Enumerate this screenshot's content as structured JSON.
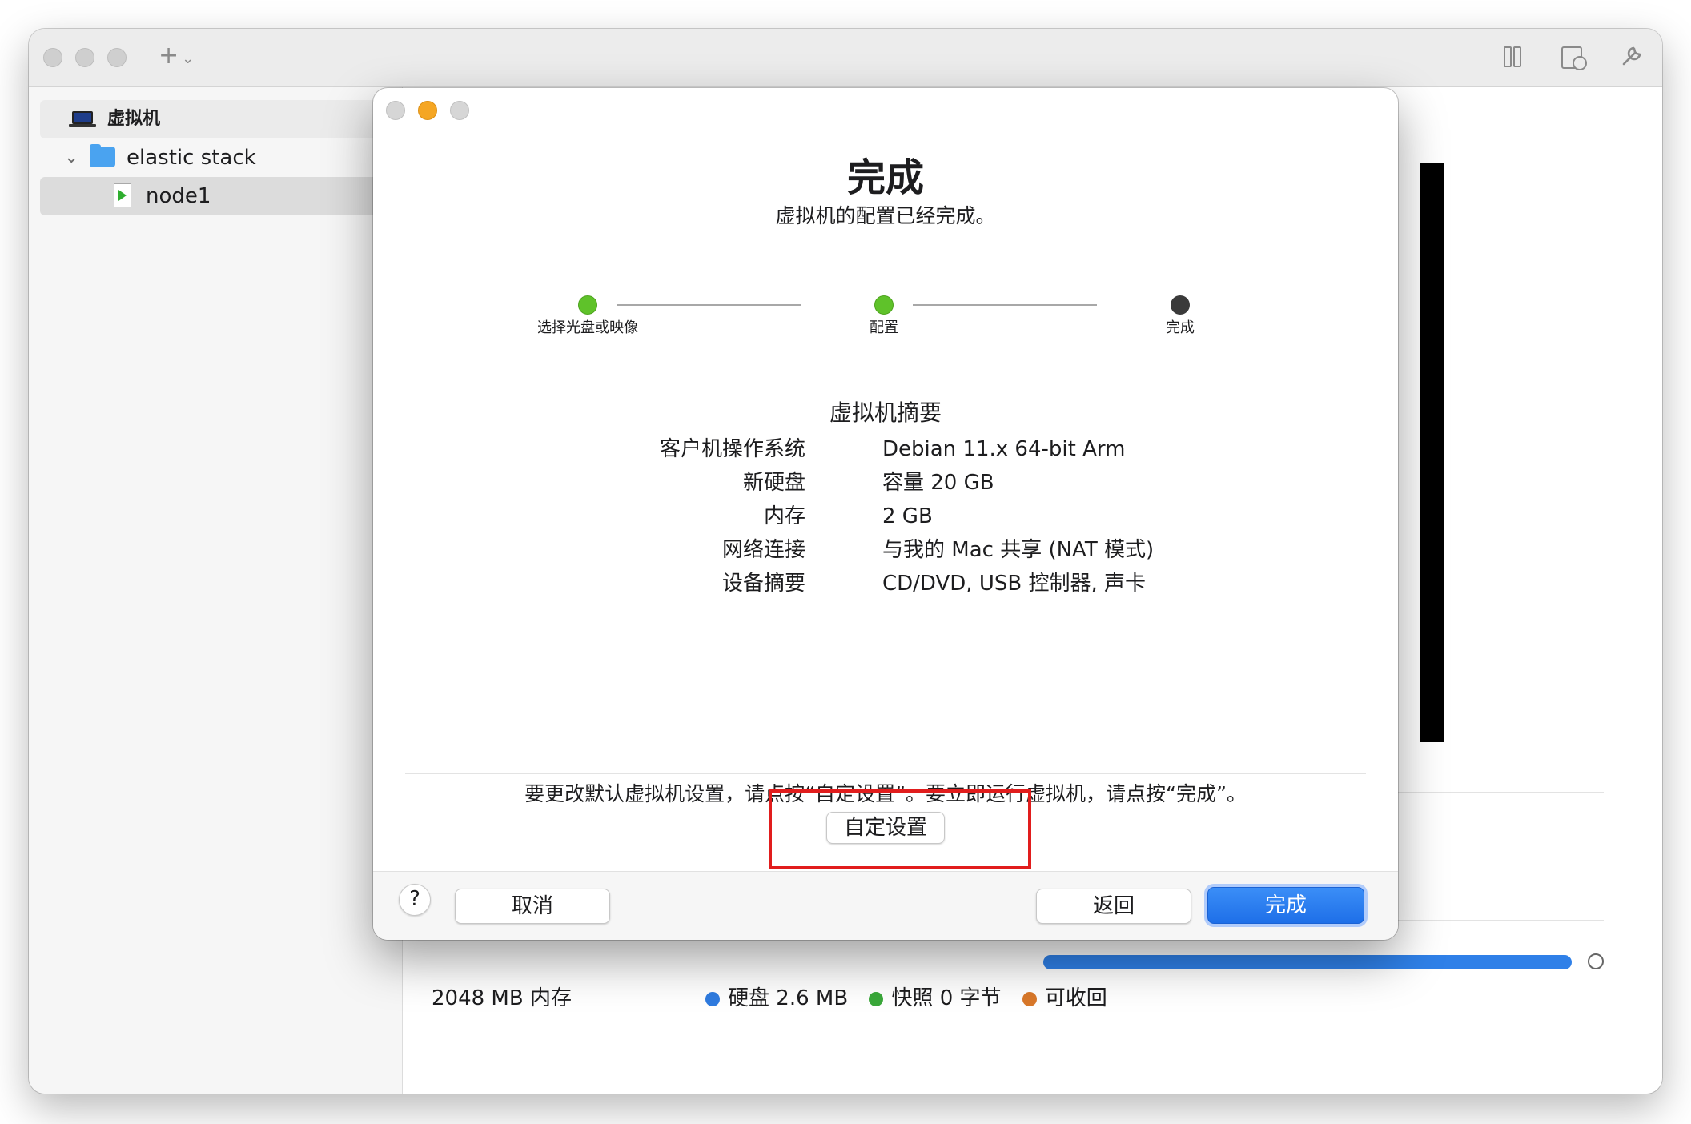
{
  "window": {
    "new_menu_label": "+",
    "toolbar_icons": [
      "pause-icon",
      "snapshot-icon",
      "settings-wrench-icon"
    ]
  },
  "sidebar": {
    "section_title": "虚拟机",
    "folder_name": "elastic stack",
    "vm_name": "node1"
  },
  "background_panel": {
    "memory_text": "2048 MB 内存",
    "legend": [
      {
        "label": "硬盘",
        "value": "2.6 MB",
        "color": "#2f7be0"
      },
      {
        "label": "快照",
        "value": "0 字节",
        "color": "#3aa83a"
      },
      {
        "label": "可收回",
        "value": "",
        "color": "#d9782a"
      }
    ],
    "accent_color": "#2f80e8"
  },
  "dialog": {
    "title": "完成",
    "subtitle": "虚拟机的配置已经完成。",
    "steps": [
      {
        "label": "选择光盘或映像",
        "status": "done",
        "color": "#5fc22a"
      },
      {
        "label": "配置",
        "status": "done",
        "color": "#5fc22a"
      },
      {
        "label": "完成",
        "status": "current",
        "color": "#3a3a3a"
      }
    ],
    "summary_title": "虚拟机摘要",
    "summary": [
      {
        "label": "客户机操作系统",
        "value": "Debian 11.x 64-bit Arm"
      },
      {
        "label": "新硬盘",
        "value": "容量 20 GB"
      },
      {
        "label": "内存",
        "value": "2 GB"
      },
      {
        "label": "网络连接",
        "value": "与我的 Mac 共享 (NAT 模式)"
      },
      {
        "label": "设备摘要",
        "value": "CD/DVD, USB 控制器, 声卡"
      }
    ],
    "instruction": "要更改默认虚拟机设置，请点按“自定设置”。要立即运行虚拟机，请点按“完成”。",
    "customize_button": "自定设置",
    "help_button": "?",
    "cancel_button": "取消",
    "back_button": "返回",
    "finish_button": "完成",
    "highlight_color": "#e11d1d"
  }
}
